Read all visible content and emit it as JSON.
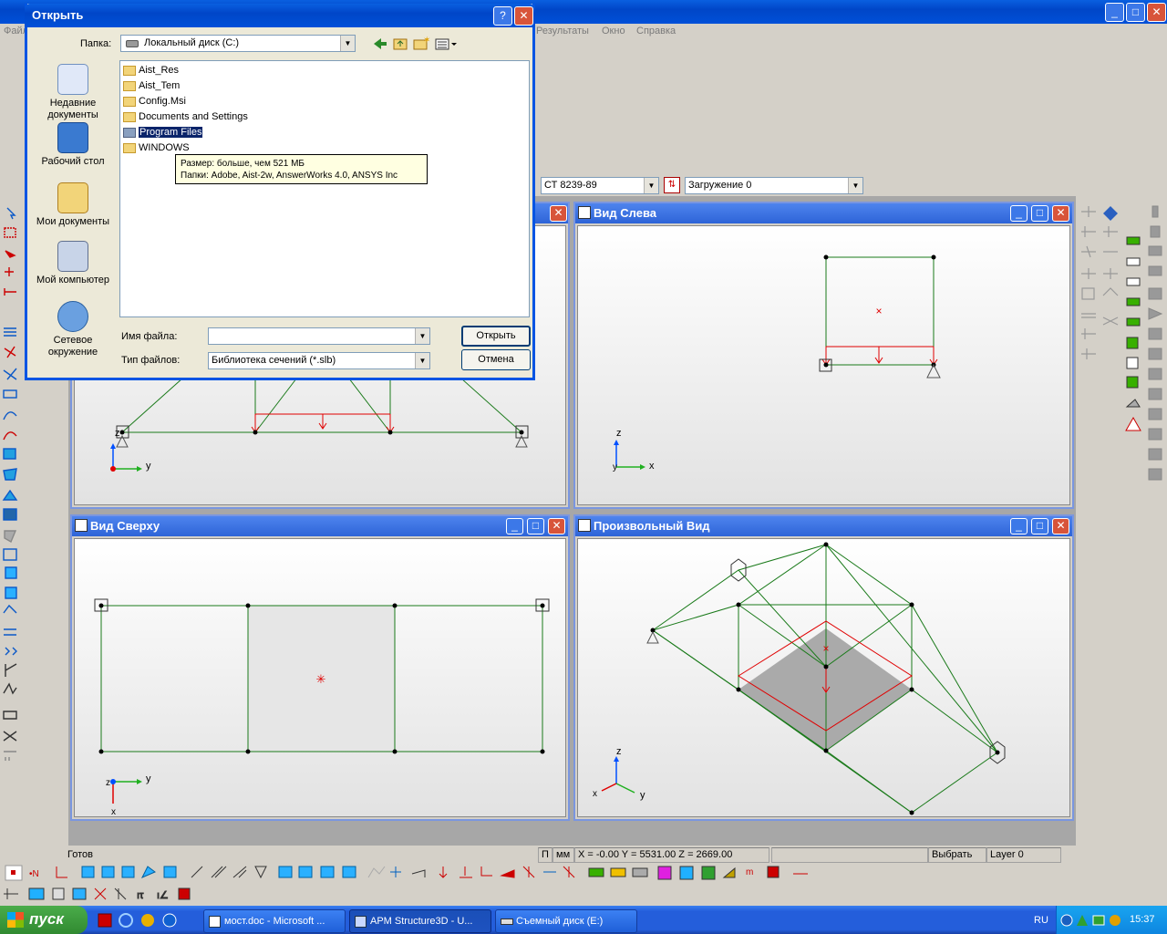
{
  "main_window": {
    "menu": [
      "Файл",
      "Результаты",
      "Окно",
      "Справка"
    ],
    "standard_combo": "СТ 8239-89",
    "load_combo": "Загружение 0"
  },
  "dialog": {
    "title": "Открыть",
    "folder_label": "Папка:",
    "folder_value": "Локальный диск (C:)",
    "places": [
      "Недавние документы",
      "Рабочий стол",
      "Мои документы",
      "Мой компьютер",
      "Сетевое окружение"
    ],
    "files": [
      "Aist_Res",
      "Aist_Tem",
      "Config.Msi",
      "Documents and Settings",
      "Program Files",
      "WINDOWS"
    ],
    "selected_file": "Program Files",
    "tooltip_line1": "Размер: больше, чем 521 МБ",
    "tooltip_line2": "Папки: Adobe, Aist-2w, AnswerWorks 4.0, ANSYS Inc",
    "filename_label": "Имя файла:",
    "filename_value": "",
    "filetype_label": "Тип файлов:",
    "filetype_value": "Библиотека сечений (*.slb)",
    "open_button": "Открыть",
    "cancel_button": "Отмена"
  },
  "views": {
    "left_title": "Вид Слева",
    "top_title": "Вид Сверху",
    "free_title": "Произвольный Вид",
    "axis_y": "y",
    "axis_z": "z",
    "axis_x": "x"
  },
  "status": {
    "ready": "Готов",
    "p": "П",
    "units": "мм",
    "coords": "X = -0.00 Y = 5531.00 Z = 2669.00",
    "mode": "Выбрать",
    "layer": "Layer 0"
  },
  "taskbar": {
    "start": "пуск",
    "tasks": [
      "мост.doc - Microsoft ...",
      "APM Structure3D - U...",
      "Съемный диск (E:)"
    ],
    "lang": "RU",
    "clock": "15:37"
  },
  "colors": {
    "model_line": "#1a7a1a",
    "load_line": "#e00000",
    "xp_blue": "#0054e3"
  }
}
